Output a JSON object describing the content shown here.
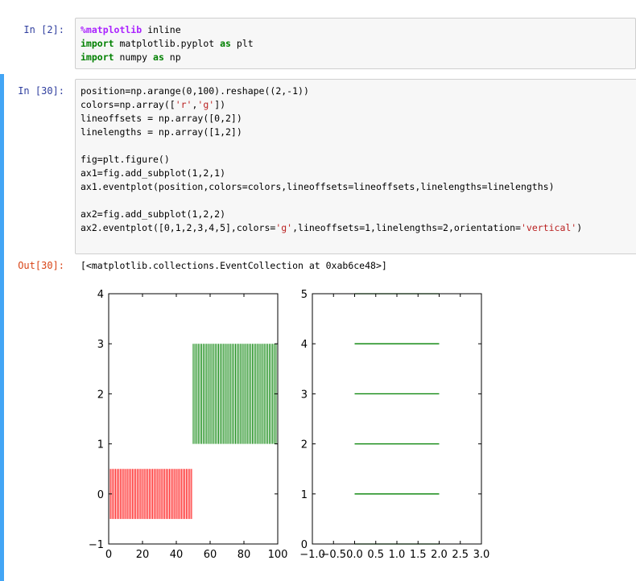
{
  "cells": [
    {
      "prompt": "In  [2]:",
      "lines": [
        [
          {
            "t": "%matplotlib",
            "c": "magic"
          },
          {
            "t": " inline"
          }
        ],
        [
          {
            "t": "import",
            "c": "kw"
          },
          {
            "t": " matplotlib.pyplot "
          },
          {
            "t": "as",
            "c": "kw"
          },
          {
            "t": " plt"
          }
        ],
        [
          {
            "t": "import",
            "c": "kw"
          },
          {
            "t": " numpy "
          },
          {
            "t": "as",
            "c": "kw"
          },
          {
            "t": " np"
          }
        ]
      ]
    },
    {
      "prompt": "In  [30]:",
      "lines": [
        [
          {
            "t": "position=np.arange(0,100).reshape((2,-1))"
          }
        ],
        [
          {
            "t": "colors=np.array(["
          },
          {
            "t": "'r'",
            "c": "str"
          },
          {
            "t": ","
          },
          {
            "t": "'g'",
            "c": "str"
          },
          {
            "t": "])"
          }
        ],
        [
          {
            "t": "lineoffsets = np.array([0,2])"
          }
        ],
        [
          {
            "t": "linelengths = np.array([1,2])"
          }
        ],
        [
          {
            "t": ""
          }
        ],
        [
          {
            "t": "fig=plt.figure()"
          }
        ],
        [
          {
            "t": "ax1=fig.add_subplot(1,2,1)"
          }
        ],
        [
          {
            "t": "ax1.eventplot(position,colors=colors,lineoffsets=lineoffsets,linelengths=linelengths)"
          }
        ],
        [
          {
            "t": ""
          }
        ],
        [
          {
            "t": "ax2=fig.add_subplot(1,2,2)"
          }
        ],
        [
          {
            "t": "ax2.eventplot([0,1,2,3,4,5],colors="
          },
          {
            "t": "'g'",
            "c": "str"
          },
          {
            "t": ",lineoffsets=1,linelengths=2,orientation="
          },
          {
            "t": "'vertical'",
            "c": "str"
          },
          {
            "t": ")"
          }
        ]
      ],
      "out_prompt": "Out[30]:",
      "output_text": "[<matplotlib.collections.EventCollection at 0xab6ce48>]"
    }
  ],
  "chart_data": [
    {
      "type": "eventplot",
      "orientation": "horizontal",
      "xlim": [
        0,
        100
      ],
      "ylim": [
        -1,
        4
      ],
      "xticks": [
        0,
        20,
        40,
        60,
        80,
        100
      ],
      "yticks": [
        -1,
        0,
        1,
        2,
        3,
        4
      ],
      "xticklabels": [
        "0",
        "20",
        "40",
        "60",
        "80",
        "100"
      ],
      "yticklabels": [
        "−1",
        "0",
        "1",
        "2",
        "3",
        "4"
      ],
      "grid": false,
      "series": [
        {
          "positions_range": [
            0,
            49
          ],
          "color": "#ff0000",
          "lineoffset": 0,
          "linelength": 1
        },
        {
          "positions_range": [
            50,
            99
          ],
          "color": "#008000",
          "lineoffset": 2,
          "linelength": 2
        }
      ]
    },
    {
      "type": "eventplot",
      "orientation": "vertical",
      "xlim": [
        -1.0,
        3.0
      ],
      "ylim": [
        0,
        5
      ],
      "xticks": [
        -1.0,
        -0.5,
        0.0,
        0.5,
        1.0,
        1.5,
        2.0,
        2.5,
        3.0
      ],
      "yticks": [
        0,
        1,
        2,
        3,
        4,
        5
      ],
      "xticklabels": [
        "−1.0",
        "−0.5",
        "0.0",
        "0.5",
        "1.0",
        "1.5",
        "2.0",
        "2.5",
        "3.0"
      ],
      "yticklabels": [
        "0",
        "1",
        "2",
        "3",
        "4",
        "5"
      ],
      "grid": false,
      "series": [
        {
          "positions": [
            0,
            1,
            2,
            3,
            4,
            5
          ],
          "color": "#008000",
          "lineoffset": 1,
          "linelength": 2
        }
      ]
    }
  ]
}
